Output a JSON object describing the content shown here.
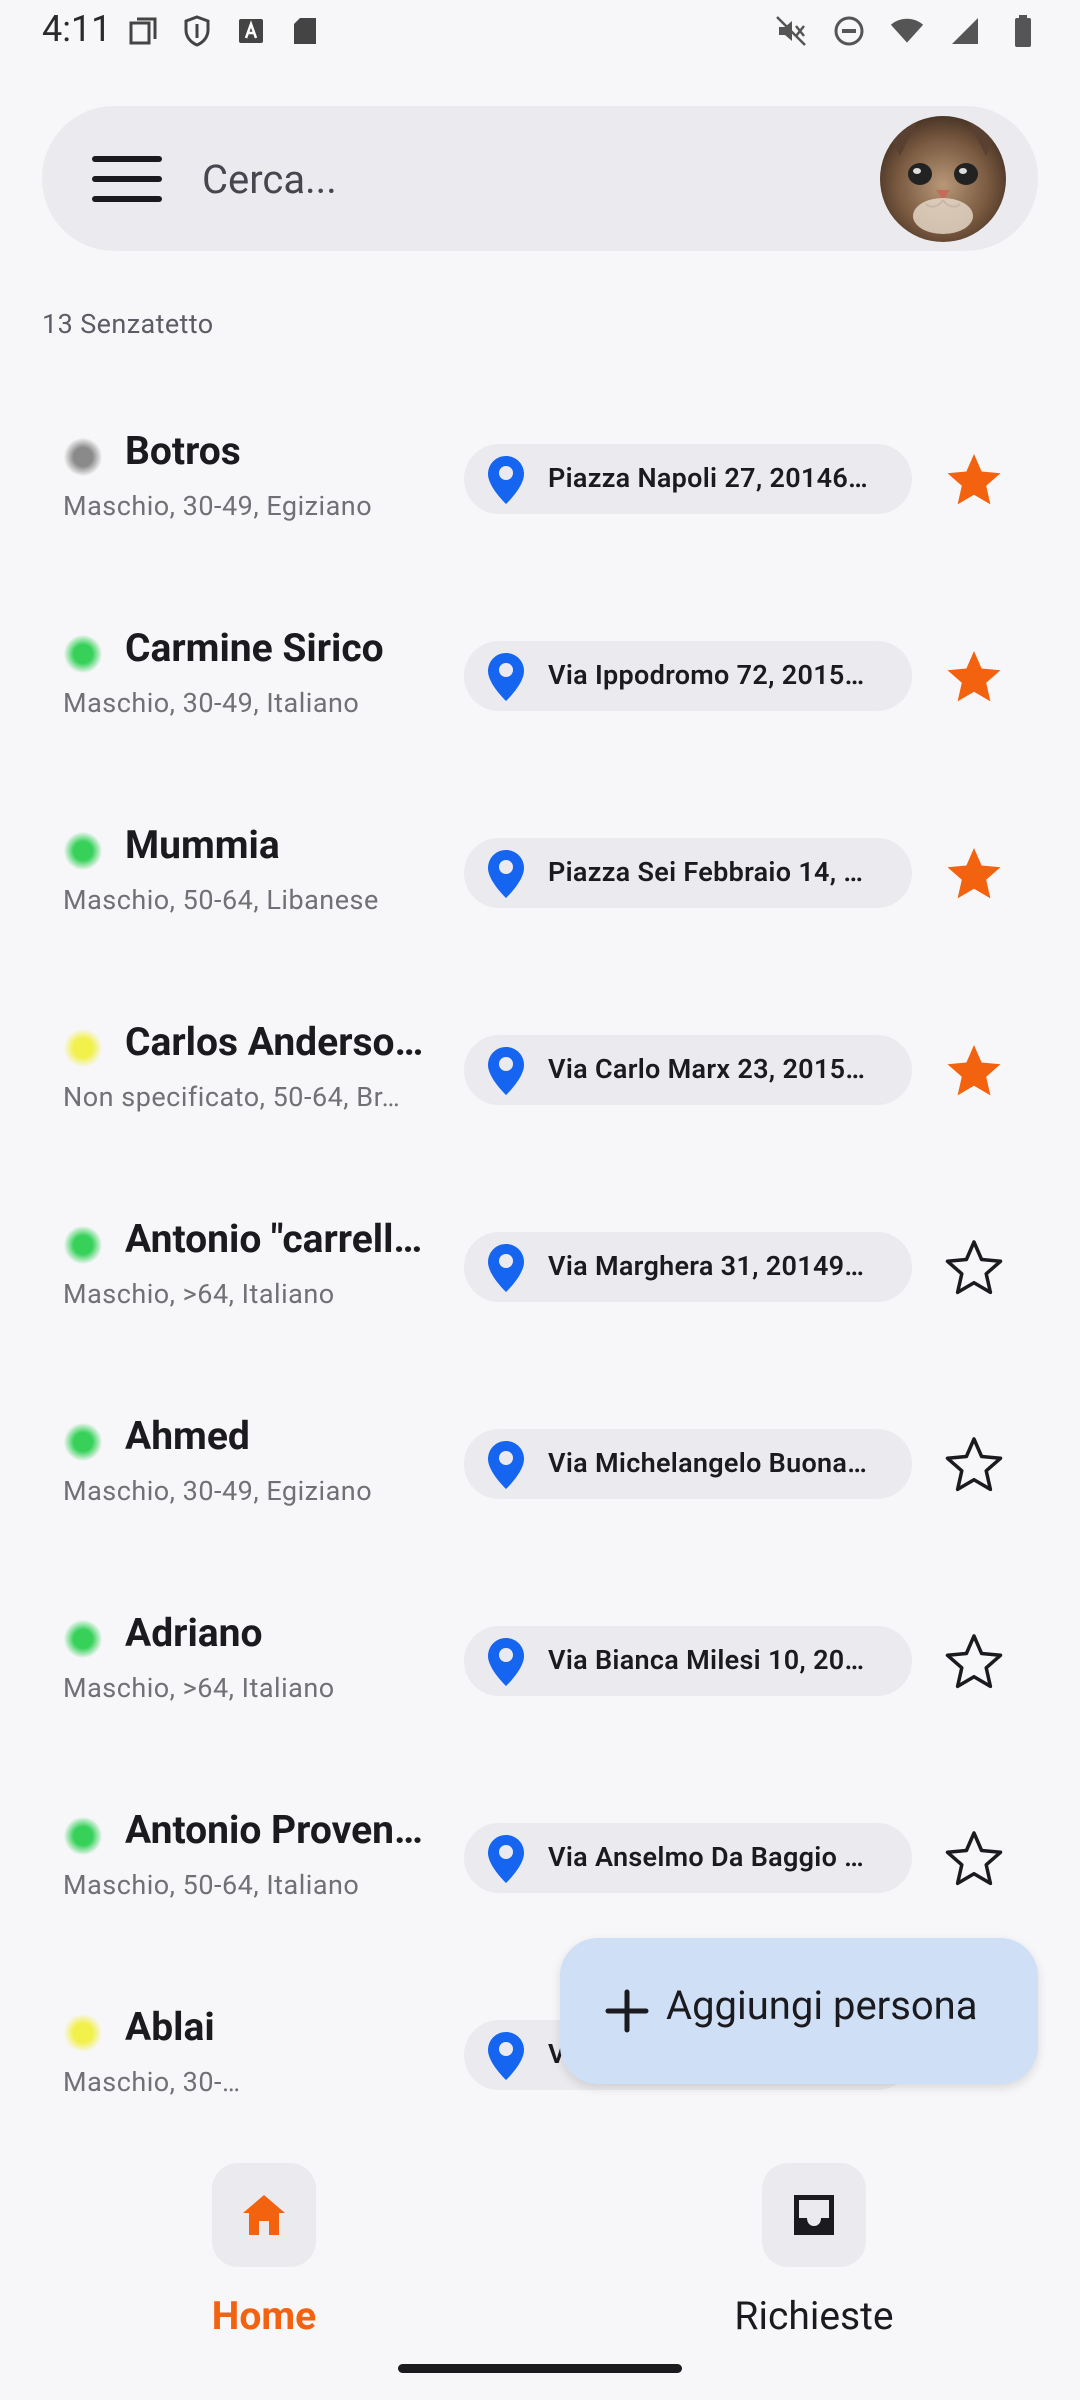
{
  "status_bar": {
    "time": "4:11"
  },
  "search": {
    "placeholder": "Cerca..."
  },
  "list_header": {
    "count_label": "13 Senzatetto"
  },
  "colors": {
    "accent_orange": "#f2620f",
    "pin_blue": "#1565f0",
    "status_green": "#37d15a",
    "status_yellow": "#f2f04a",
    "status_gray": "#8a8a8a"
  },
  "people": [
    {
      "name": "Botros",
      "details": "Maschio, 30-49,  Egiziano",
      "address": "Piazza Napoli 27, 20146…",
      "status": "gray",
      "favorite": true
    },
    {
      "name": "Carmine Sirico",
      "details": "Maschio, 30-49,  Italiano",
      "address": "Via Ippodromo 72, 2015…",
      "status": "green",
      "favorite": true
    },
    {
      "name": "Mummia",
      "details": "Maschio, 50-64,  Libanese",
      "address": "Piazza Sei Febbraio 14, …",
      "status": "green",
      "favorite": true
    },
    {
      "name": "Carlos Anderso…",
      "details": "Non specificato, 50-64,  Br…",
      "address": "Via Carlo Marx 23, 2015…",
      "status": "yellow",
      "favorite": true
    },
    {
      "name": "Antonio \"carrell…",
      "details": "Maschio, >64,  Italiano",
      "address": "Via Marghera 31, 20149…",
      "status": "green",
      "favorite": false
    },
    {
      "name": "Ahmed",
      "details": "Maschio, 30-49,  Egiziano",
      "address": "Via Michelangelo Buona…",
      "status": "green",
      "favorite": false
    },
    {
      "name": "Adriano",
      "details": "Maschio, >64,  Italiano",
      "address": "Via Bianca Milesi 10, 20…",
      "status": "green",
      "favorite": false
    },
    {
      "name": "Antonio Proven…",
      "details": "Maschio, 50-64,  Italiano",
      "address": "Via Anselmo Da Baggio …",
      "status": "green",
      "favorite": false
    },
    {
      "name": "Ablai",
      "details": "Maschio, 30-…",
      "address": "V",
      "status": "yellow",
      "favorite": false
    }
  ],
  "fab": {
    "label": "Aggiungi persona"
  },
  "bottom_nav": {
    "items": [
      {
        "label": "Home",
        "icon": "home-icon",
        "active": true
      },
      {
        "label": "Richieste",
        "icon": "inbox-icon",
        "active": false
      }
    ]
  }
}
